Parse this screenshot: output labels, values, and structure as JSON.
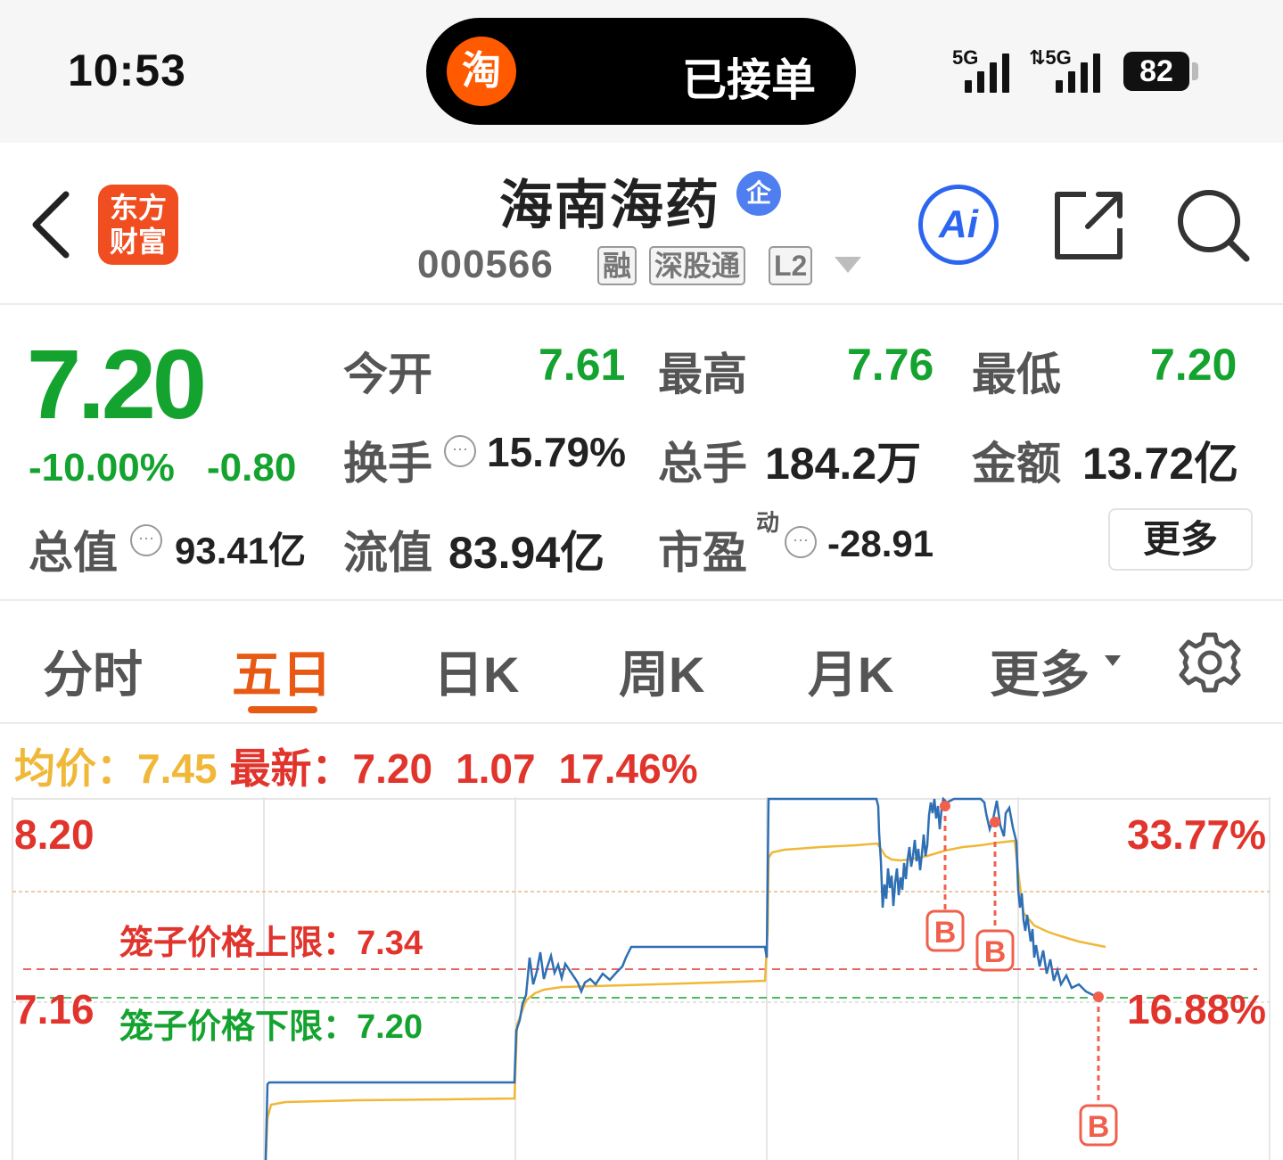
{
  "status_bar": {
    "time": "10:53",
    "island_app_glyph": "淘",
    "island_text": "已接单",
    "signal1_label": "5G",
    "signal2_label": "⇅5G",
    "battery": "82"
  },
  "header": {
    "logo_line1": "东方",
    "logo_line2": "财富",
    "stock_name": "海南海药",
    "enterprise_badge": "企",
    "stock_code": "000566",
    "tags": [
      "融",
      "深股通",
      "L2"
    ],
    "ai_label": "Ai"
  },
  "quote": {
    "price": "7.20",
    "change_pct": "-10.00%",
    "change": "-0.80",
    "open_label": "今开",
    "open": "7.61",
    "high_label": "最高",
    "high": "7.76",
    "low_label": "最低",
    "low": "7.20",
    "turnover_label": "换手",
    "turnover": "15.79%",
    "volume_label": "总手",
    "volume": "184.2万",
    "amount_label": "金额",
    "amount": "13.72亿",
    "mktcap_label": "总值",
    "mktcap": "93.41亿",
    "float_label": "流值",
    "float": "83.94亿",
    "pe_label": "市盈",
    "pe_superscript": "动",
    "pe": "-28.91",
    "more_label": "更多"
  },
  "tabs": {
    "items": [
      "分时",
      "五日",
      "日K",
      "周K",
      "月K",
      "更多"
    ],
    "active": "五日"
  },
  "chart_info": {
    "avg_label": "均价：",
    "avg": "7.45",
    "latest_label": "最新：",
    "latest": "7.20",
    "volume": "1.07",
    "pct": "17.46%"
  },
  "chart_data": {
    "type": "line",
    "y_left_ticks": [
      "8.20",
      "7.16"
    ],
    "y_right_ticks": [
      "33.77%",
      "16.88%"
    ],
    "annotations": [
      {
        "text": "笼子价格上限：7.34",
        "value": 7.34,
        "color": "#e0342c"
      },
      {
        "text": "笼子价格下限：7.20",
        "value": 7.2,
        "color": "#14a32f"
      }
    ],
    "markers": [
      "B",
      "B",
      "B"
    ],
    "colors": {
      "price": "#2f6fb3",
      "avg": "#f0b838",
      "upper": "#e0342c",
      "lower": "#14a32f",
      "marker": "#f0604c"
    },
    "days": 5
  }
}
